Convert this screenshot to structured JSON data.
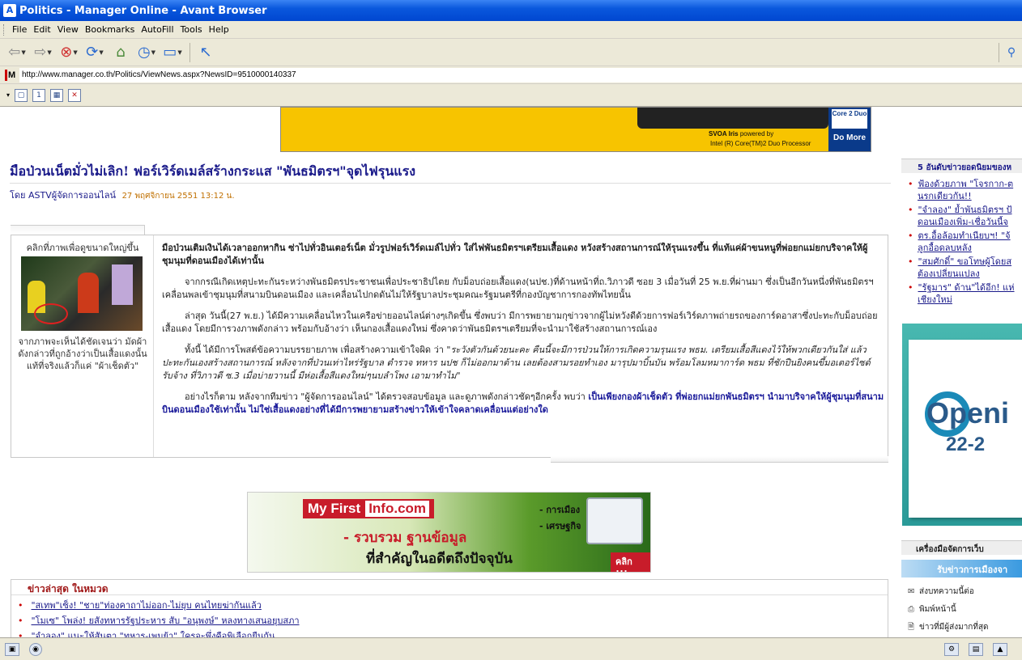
{
  "window": {
    "title": "Politics - Manager Online - Avant Browser"
  },
  "menu": [
    "File",
    "Edit",
    "View",
    "Bookmarks",
    "AutoFill",
    "Tools",
    "Help"
  ],
  "address": {
    "url": "http://www.manager.co.th/Politics/ViewNews.aspx?NewsID=9510000140337"
  },
  "banner_top": {
    "brand": "SVOA Iris",
    "powered": "powered by",
    "processor": "Intel (R) Core(TM)2 Duo Processor",
    "chip": "Core 2 Duo",
    "cta": "Do More"
  },
  "article": {
    "headline": "มือป่วนเน็ตมั่วไม่เลิก! ฟอร์เวิร์ดเมล์สร้างกระแส \"พันธมิตรฯ\"จุดไฟรุนแรง",
    "byline": "โดย ASTVผู้จัดการออนไลน์",
    "date": "27 พฤศจิกายน 2551 13:12 น.",
    "image_caption_top": "คลิกที่ภาพเพื่อดูขนาดใหญ่ขึ้น",
    "image_caption": "จากภาพจะเห็นได้ชัดเจนว่า มัดผ้าดังกล่าวที่ถูกอ้างว่าเป็นเสื้อแดงนั้น แท้ที่จริงแล้วก็แค่ \"ผ้าเช็ดตัว\"",
    "lead": "มือป่วนเติมเงินได้เวลาออกหากิน ซ่าไปทั่วอินเตอร์เน็ต มั่วรูปฟอร์เวิร์ดเมล์ไปทั่ว ใส่ไฟพันธมิตรฯเตรียมเสื้อแดง หวังสร้างสถานการณ์ให้รุนแรงขึ้น ที่แท้แค่ผ้าขนหนูที่พ่อยกแม่ยกบริจาคให้ผู้ชุมนุมที่ดอนเมืองได้เท่านั้น",
    "p1": "จากกรณีเกิดเหตุปะทะกันระหว่างพันธมิตรประชาชนเพื่อประชาธิปไตย กับม็อบถ่อยเสื้อแดง(นปช.)ที่ด้านหน้าที่ถ.วิภาวดี ซอย 3 เมื่อวันที่ 25 พ.ย.ที่ผ่านมา ซึ่งเป็นอีกวันหนึ่งที่พันธมิตรฯเคลื่อนพลเข้าชุมนุมที่สนามบินดอนเมือง และเคลื่อนไปกดดันไม่ให้รัฐบาลประชุมคณะรัฐมนตรีที่กองบัญชาการกองทัพไทยนั้น",
    "p2": "ล่าสุด วันนี้(27 พ.ย.) ได้มีความเคลื่อนไหวในเครือข่ายออนไลน์ต่างๆเกิดขึ้น ซึ่งพบว่า มีการพยายามกุข่าวจากผู้ไม่หวังดีด้วยการฟอร์เวิร์ดภาพถ่ายรถของการ์ดอาสาซึ่งปะทะกับม็อบถ่อยเสื้อแดง โดยมีการวงภาพดังกล่าว พร้อมกับอ้างว่า เห็นกองเสื้อแดงใหม่ ซึ่งคาดว่าพันธมิตรฯเตรียมที่จะนำมาใช้สร้างสถานการณ์เอง",
    "p3a": "ทั้งนี้ ได้มีการโพสต์ข้อความบรรยายภาพ เพื่อสร้างความเข้าใจผิด ว่า ",
    "p3b": "\"ระวังตัวกันด้วยนะคะ คืนนี้จะมีการป่วนให้การเกิดความรุนแรง พธม. เตรียมเสื้อสีแดงไว้ให้พวกเดียวกันใส่ แล้วปะทะกันเองสร้างสถานการณ์ หลังจากที่ป่วนเท่าไหร่รัฐบาล ตำรวจ ทหาร นปช ก็ไม่ออกมาต้าน เลยต้องสามรอยทำเอง มารุปมาบิ้นบัน พร้อมโลมหมาการ์ด พธม ที่ชักปืนยิงคนขึ้มอเตอร์ไซด์รับจ้าง ที่วิภาวดี ซ.3 เมื่อบ่ายวานนี้ มีห่อเสื้อสีแดงใหม่ๆนบลำโพง เอามาทำไม\"",
    "p4a": "อย่างไรก็ตาม หลังจากทีมข่าว \"ผู้จัดการออนไลน์\" ได้ตรวจสอบข้อมูล และดูภาพดังกล่าวชัดๆอีกครั้ง พบว่า ",
    "p4b": "เป็นเพียงกองผ้าเช็ดตัว ที่พ่อยกแม่ยกพันธมิตรฯ นำมาบริจาคให้ผู้ชุมนุมที่สนามบินดอนเมืองใช้เท่านั้น ไม่ใช่เสื้อแดงอย่างที่ได้มีการพยายามสร้างข่าวให้เข้าใจคลาดเคลื่อนแต่อย่างใด"
  },
  "mid_banner": {
    "brand_a": "My First",
    "brand_b": "Info.com",
    "line1": "- รวบรวม ฐานข้อมูล",
    "line2": "ที่สำคัญในอดีตถึงปัจจุบัน",
    "k1": "- การเมือง",
    "k2": "- เศรษฐกิจ",
    "cta": "คลิก !!!"
  },
  "news_box": {
    "header": "ข่าวล่าสุด ในหมวด",
    "items": [
      "\"สเทพ\"เซ็ง! \"ชาย\"ท่องคาถาไม่ออก-ไม่ยุบ คนไทยฆ่ากันแล้ว",
      "\"โมเซ\" โพล่ง! ยสังทหารรัฐประหาร สับ \"อนุพงษ์\" หลงทางเสนอยุบสภา",
      "\"จำลอง\" แนะให้สันตา \"ทหาร-เพมย้า\" ใครจะพึ่งคือพิเลือกยืนกัน"
    ]
  },
  "right_col": {
    "header": "5 อันดับข่าวยอดนิยมของห",
    "items": [
      [
        "ฟ้องด้วยภาพ \"โจรกาก-ต",
        "นรกเดียวกัน!!"
      ],
      [
        "\"จำลอง\" ย้ำพันธมิตรฯ ป้",
        "ดอนเมืองเพิ่ม-เชื่อวันนี้จ"
      ],
      [
        "ตร.อื้อล้อมทำเนียบฯ! \"จ้",
        "ลูกอื้อดลบหลัง"
      ],
      [
        "\"สมศักดิ์\" ขอโทษผู้โดยส",
        "ต้องเปลี่ยนแปลง"
      ],
      [
        "\"รัฐมาร\" ด้าน\"ได้อีก! แห่",
        "เชียงใหม่"
      ]
    ],
    "banner_text1": "Openi",
    "banner_text2": "22-2",
    "tools_header": "เครื่องมือจัดการเว็บ",
    "tools_sub": "รับข่าวการเมืองจา",
    "tools": [
      "ส่งบทความนี้ต่อ",
      "พิมพ์หน้านี้",
      "ข่าวที่มีผู้ส่งมากที่สุด"
    ]
  }
}
